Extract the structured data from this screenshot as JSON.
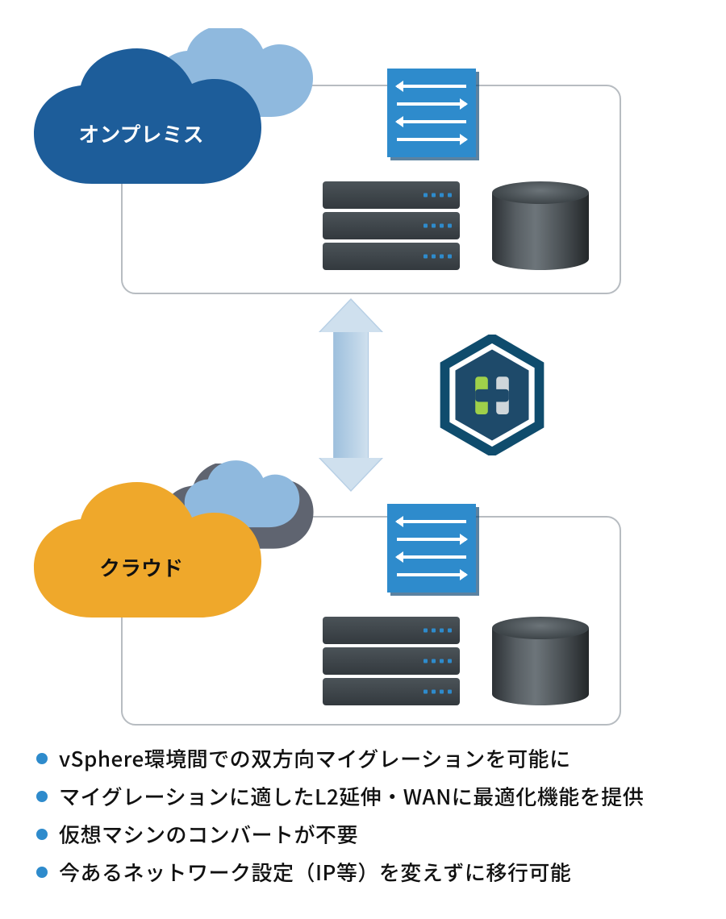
{
  "zones": {
    "onprem": {
      "label": "オンプレミス"
    },
    "cloud": {
      "label": "クラウド"
    }
  },
  "icons": {
    "switch_top": "network-switch-icon",
    "switch_bottom": "network-switch-icon",
    "server_top": "server-stack-icon",
    "server_bottom": "server-stack-icon",
    "storage_top": "storage-cylinder-icon",
    "storage_bottom": "storage-cylinder-icon",
    "arrow": "bidirectional-arrow-icon",
    "hex": "hcx-hexagon-icon"
  },
  "colors": {
    "onprem_cloud": "#1d5d9a",
    "onprem_cloud_back": "#8fb9de",
    "cloud_cloud": "#efa82b",
    "cloud_cloud_back": "#5f6470",
    "accent": "#2e8bcc"
  },
  "bullets": [
    "vSphere環境間での双方向マイグレーションを可能に",
    "マイグレーションに適したL2延伸・WANに最適化機能を提供",
    "仮想マシンのコンバートが不要",
    "今あるネットワーク設定（IP等）を変えずに移行可能"
  ]
}
